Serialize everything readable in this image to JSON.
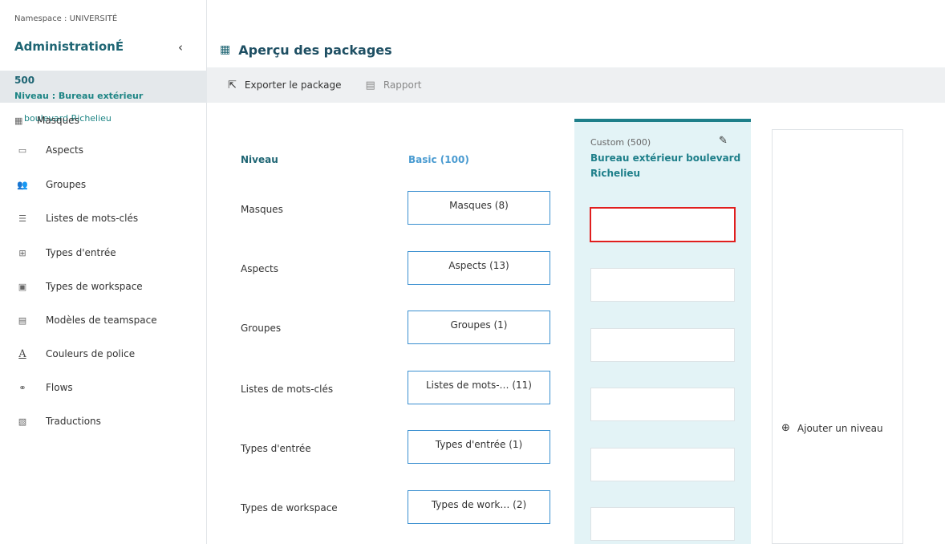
{
  "sidebar": {
    "namespace": "Namespace : UNIVERSITÉ",
    "title": "AdministrationÉ",
    "collapse": "‹",
    "level_num": "500",
    "level_name": "Niveau : Bureau extérieur",
    "level_name_cont": "boulevard Richelieu",
    "items": [
      {
        "label": "Masques",
        "icon": "▦"
      },
      {
        "label": "Aspects",
        "icon": "▭"
      },
      {
        "label": "Groupes",
        "icon": "👥"
      },
      {
        "label": "Listes de mots-clés",
        "icon": "☰"
      },
      {
        "label": "Types d'entrée",
        "icon": "⊞"
      },
      {
        "label": "Types de workspace",
        "icon": "▣"
      },
      {
        "label": "Modèles de teamspace",
        "icon": "▤"
      },
      {
        "label": "Couleurs de police",
        "icon": "A"
      },
      {
        "label": "Flows",
        "icon": "⚭"
      },
      {
        "label": "Traductions",
        "icon": "▧"
      }
    ]
  },
  "header": {
    "title": "Aperçu des packages",
    "icon": "▦"
  },
  "toolbar": {
    "export_label": "Exporter le package",
    "export_icon": "⇱",
    "report_label": "Rapport",
    "report_icon": "▤"
  },
  "grid": {
    "level_header": "Niveau",
    "basic_header": "Basic (100)",
    "rows": [
      {
        "label": "Masques",
        "basic": "Masques  (8)"
      },
      {
        "label": "Aspects",
        "basic": "Aspects  (13)"
      },
      {
        "label": "Groupes",
        "basic": "Groupes  (1)"
      },
      {
        "label": "Listes de mots-clés",
        "basic": "Listes de mots-…  (11)"
      },
      {
        "label": "Types d'entrée",
        "basic": "Types d'entrée  (1)"
      },
      {
        "label": "Types de workspace",
        "basic": "Types de work…  (2)"
      }
    ],
    "custom_sub": "Custom (500)",
    "custom_name": "Bureau extérieur boulevard Richelieu",
    "edit_icon": "✎",
    "add_level": "Ajouter un niveau",
    "add_icon": "⊕"
  },
  "colors": {
    "accent": "#1e7f8a",
    "selection": "#e01e1e",
    "link": "#4a9bd1"
  }
}
